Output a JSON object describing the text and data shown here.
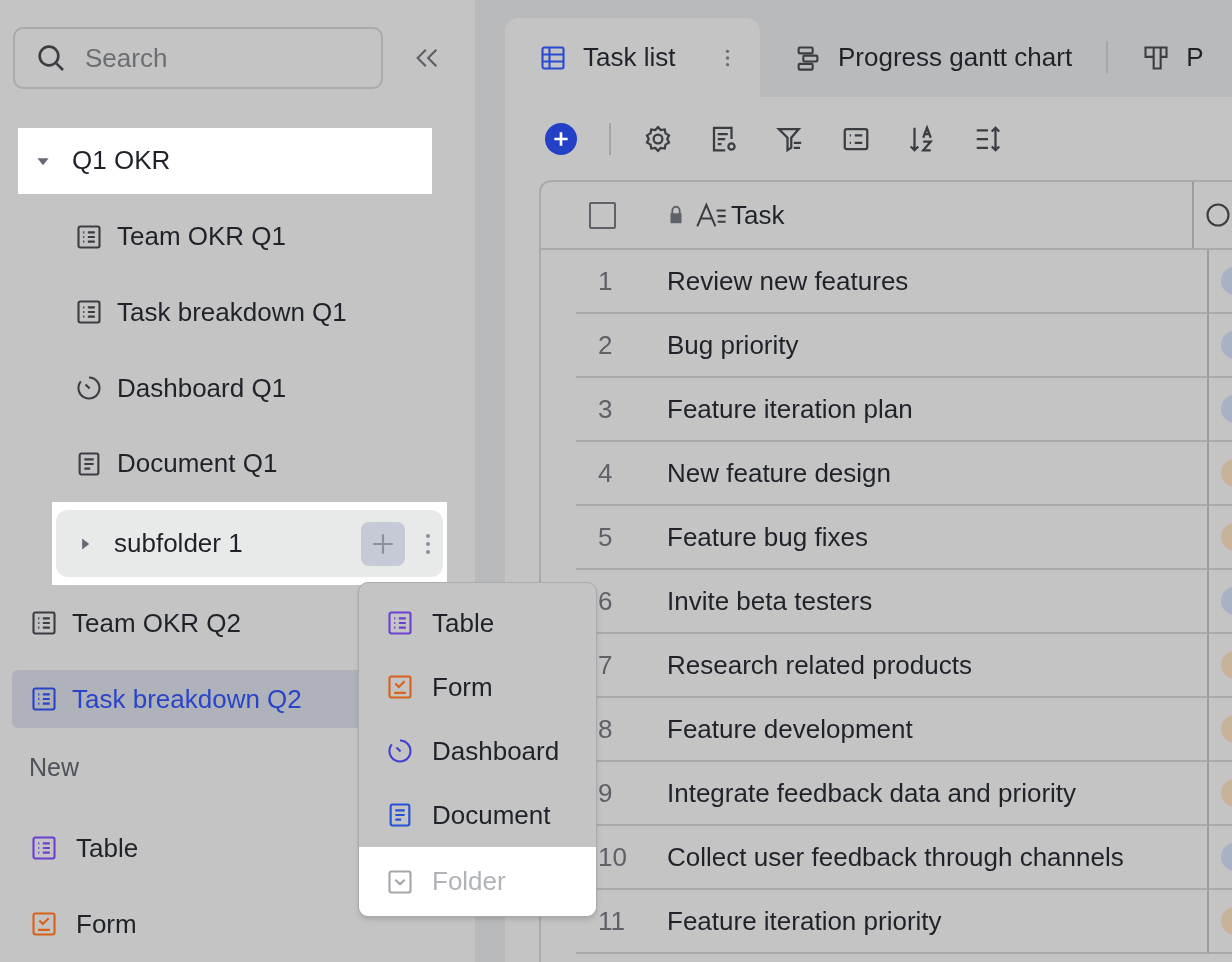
{
  "sidebar": {
    "search": {
      "placeholder": "Search"
    },
    "tree": [
      {
        "label": "Q1 OKR",
        "kind": "folder",
        "expanded": true,
        "selected": false,
        "highlighted": true,
        "children": [
          {
            "label": "Team OKR Q1",
            "kind": "table",
            "selected": false,
            "highlighted": false
          },
          {
            "label": "Task breakdown Q1",
            "kind": "table",
            "selected": false,
            "highlighted": false
          },
          {
            "label": "Dashboard Q1",
            "kind": "dashboard",
            "selected": false,
            "highlighted": false
          },
          {
            "label": "Document Q1",
            "kind": "document",
            "selected": false,
            "highlighted": false
          },
          {
            "label": "subfolder 1",
            "kind": "folder",
            "expanded": false,
            "selected": false,
            "highlighted": true
          }
        ]
      },
      {
        "label": "Team OKR Q2",
        "kind": "table",
        "selected": false,
        "highlighted": false
      },
      {
        "label": "Task breakdown Q2",
        "kind": "table",
        "selected": true,
        "highlighted": false
      }
    ],
    "new_section": {
      "title": "New",
      "items": [
        {
          "label": "Table",
          "kind": "table"
        },
        {
          "label": "Form",
          "kind": "form"
        }
      ]
    }
  },
  "add_menu": {
    "items": [
      {
        "label": "Table",
        "kind": "table",
        "disabled": false,
        "highlighted": false
      },
      {
        "label": "Form",
        "kind": "form",
        "disabled": false,
        "highlighted": false
      },
      {
        "label": "Dashboard",
        "kind": "dashboard",
        "disabled": false,
        "highlighted": false
      },
      {
        "label": "Document",
        "kind": "document",
        "disabled": false,
        "highlighted": false
      },
      {
        "label": "Folder",
        "kind": "folder",
        "disabled": true,
        "highlighted": true
      }
    ]
  },
  "tabs": [
    {
      "label": "Task list",
      "kind": "grid",
      "selected": true
    },
    {
      "label": "Progress gantt chart",
      "kind": "gantt",
      "selected": false
    },
    {
      "label": "P",
      "kind": "kanban",
      "selected": false
    }
  ],
  "table": {
    "header_checkbox": {
      "checked": false
    },
    "columns": [
      {
        "label": "Task"
      }
    ],
    "rows": [
      {
        "number": "1",
        "task": "Review new features",
        "color": "#a9b1c6"
      },
      {
        "number": "2",
        "task": "Bug priority",
        "color": "#a9b1c6"
      },
      {
        "number": "3",
        "task": "Feature iteration plan",
        "color": "#a9b1c6"
      },
      {
        "number": "4",
        "task": "New feature design",
        "color": "#c8b39a"
      },
      {
        "number": "5",
        "task": "Feature bug fixes",
        "color": "#c8b39a"
      },
      {
        "number": "6",
        "task": "Invite beta testers",
        "color": "#a9b1c6"
      },
      {
        "number": "7",
        "task": "Research related products",
        "color": "#c8b39a"
      },
      {
        "number": "8",
        "task": "Feature development",
        "color": "#c8b39a"
      },
      {
        "number": "9",
        "task": "Integrate feedback data and priority",
        "color": "#c8b39a"
      },
      {
        "number": "10",
        "task": "Collect user feedback through channels",
        "color": "#a9b1c6"
      },
      {
        "number": "11",
        "task": "Feature iteration priority",
        "color": "#c8b39a"
      }
    ]
  }
}
